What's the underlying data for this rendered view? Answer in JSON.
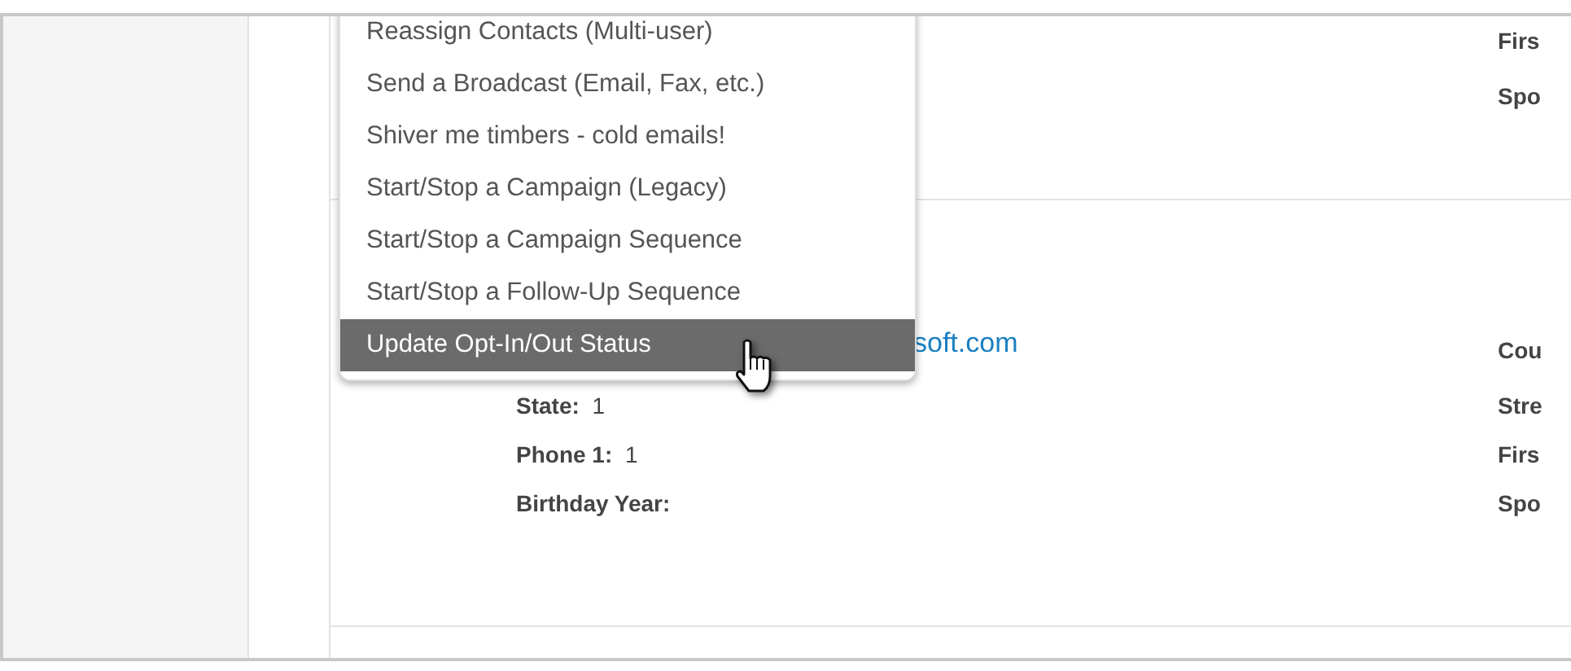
{
  "actions_menu": {
    "items": [
      {
        "label": "Reassign Contacts (Multi-user)",
        "selected": false
      },
      {
        "label": "Send a Broadcast (Email, Fax, etc.)",
        "selected": false
      },
      {
        "label": "Shiver me timbers - cold emails!",
        "selected": false
      },
      {
        "label": "Start/Stop a Campaign (Legacy)",
        "selected": false
      },
      {
        "label": "Start/Stop a Campaign Sequence",
        "selected": false
      },
      {
        "label": "Start/Stop a Follow-Up Sequence",
        "selected": false
      },
      {
        "label": "Update Opt-In/Out Status",
        "selected": true
      }
    ]
  },
  "records": [
    {
      "right_labels": [
        "Firs",
        "Spo"
      ]
    },
    {
      "left_fields": [
        {
          "kind": "link",
          "value": "soft.com"
        },
        {
          "kind": "field",
          "label": "State:",
          "value": "1"
        },
        {
          "kind": "field",
          "label": "Phone 1:",
          "value": "1"
        },
        {
          "kind": "field",
          "label": "Birthday Year:"
        }
      ],
      "right_labels": [
        "Cou",
        "Stre",
        "Firs",
        "Spo"
      ]
    }
  ]
}
